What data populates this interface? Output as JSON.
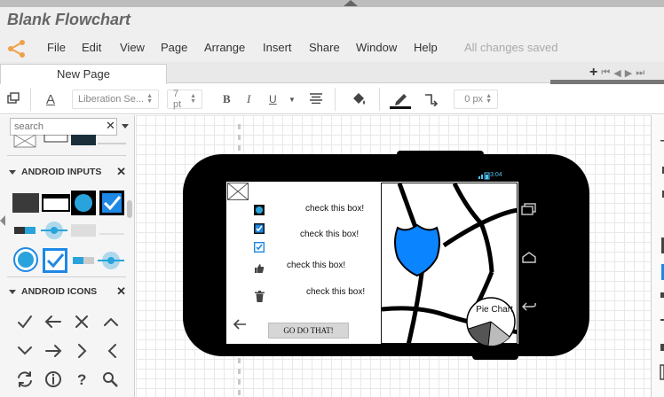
{
  "app": {
    "title": "Blank Flowchart",
    "status": "All changes saved",
    "menu": [
      "File",
      "Edit",
      "View",
      "Page",
      "Arrange",
      "Insert",
      "Share",
      "Window",
      "Help"
    ]
  },
  "tabs": {
    "active": "New Page",
    "add": "+"
  },
  "toolbar": {
    "font_family": "Liberation Se...",
    "font_size": "7 pt",
    "bold": "B",
    "italic": "I",
    "underline": "U",
    "text_color_glyph": "A",
    "line_width": "0 px"
  },
  "sidebar": {
    "search": {
      "placeholder": "search",
      "value": ""
    },
    "sections": [
      {
        "title": "ANDROID INPUTS"
      },
      {
        "title": "ANDROID ICONS"
      }
    ]
  },
  "mockup": {
    "status_time": "3:04",
    "checkbox_labels": [
      "check this box!",
      "check this box!",
      "check this box!",
      "check this box!"
    ],
    "button_label": "GO DO THAT!",
    "pie_label": "Pie Chart"
  },
  "colors": {
    "accent_blue": "#1e88e5",
    "frame_black": "#000000",
    "shield_blue": "#0a84ff",
    "logo_orange": "#f0a04b"
  }
}
